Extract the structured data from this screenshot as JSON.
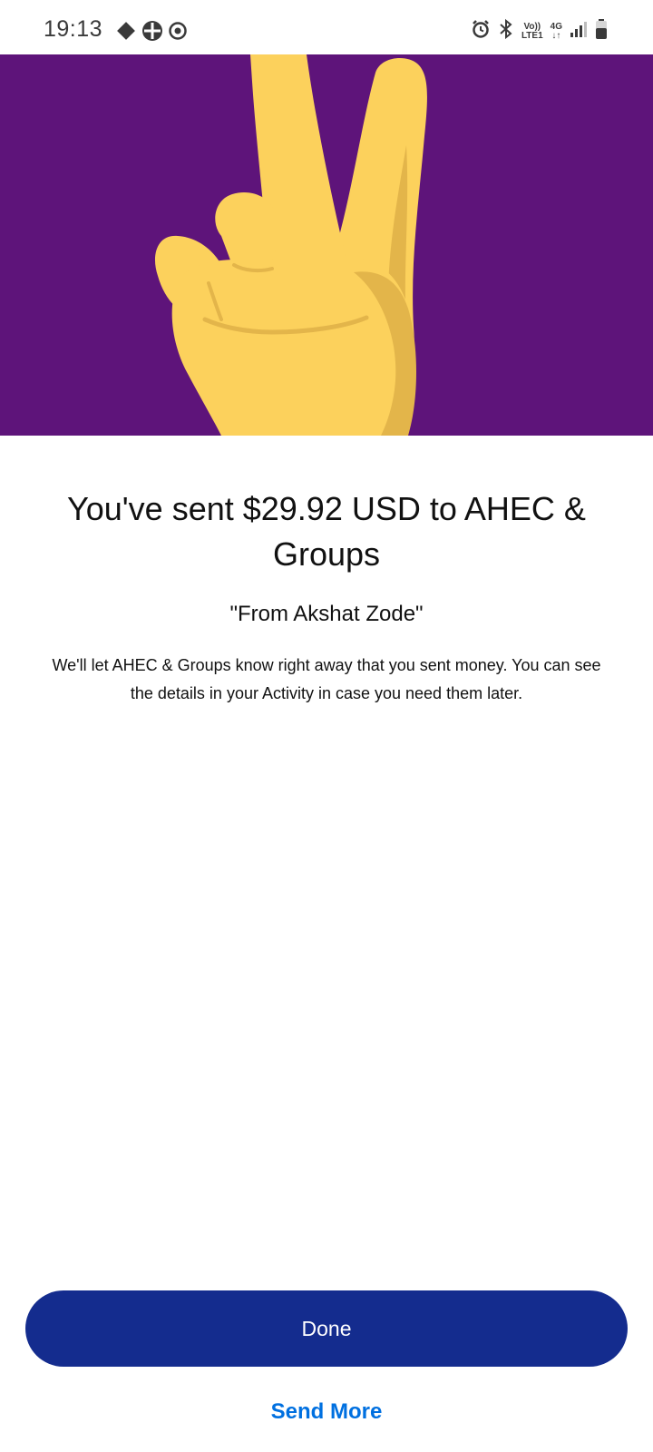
{
  "status_bar": {
    "time": "19:13",
    "left_icons": [
      "navigation-diamond-icon",
      "app-grid-icon",
      "app-circle-icon"
    ],
    "right_icons": [
      "alarm-icon",
      "bluetooth-icon",
      "volte-icon",
      "data-4g-icon",
      "signal-icon",
      "battery-icon"
    ],
    "volte_top": "Vo))",
    "volte_bottom": "LTE1",
    "data_top": "4G",
    "data_bottom": "↓↑"
  },
  "hero": {
    "background_color": "#5e147a",
    "illustration": "victory-hand-illustration"
  },
  "confirmation": {
    "headline": "You've sent $29.92 USD to AHEC & Groups",
    "note": "\"From Akshat Zode\"",
    "description": "We'll let AHEC & Groups know right away that you sent money. You can see the details in your Activity in case you need them later."
  },
  "actions": {
    "done_label": "Done",
    "send_more_label": "Send More"
  },
  "colors": {
    "primary_button": "#142c8e",
    "link": "#0070e0",
    "hand": "#fcd15c",
    "hand_shadow": "#e3b54a"
  }
}
